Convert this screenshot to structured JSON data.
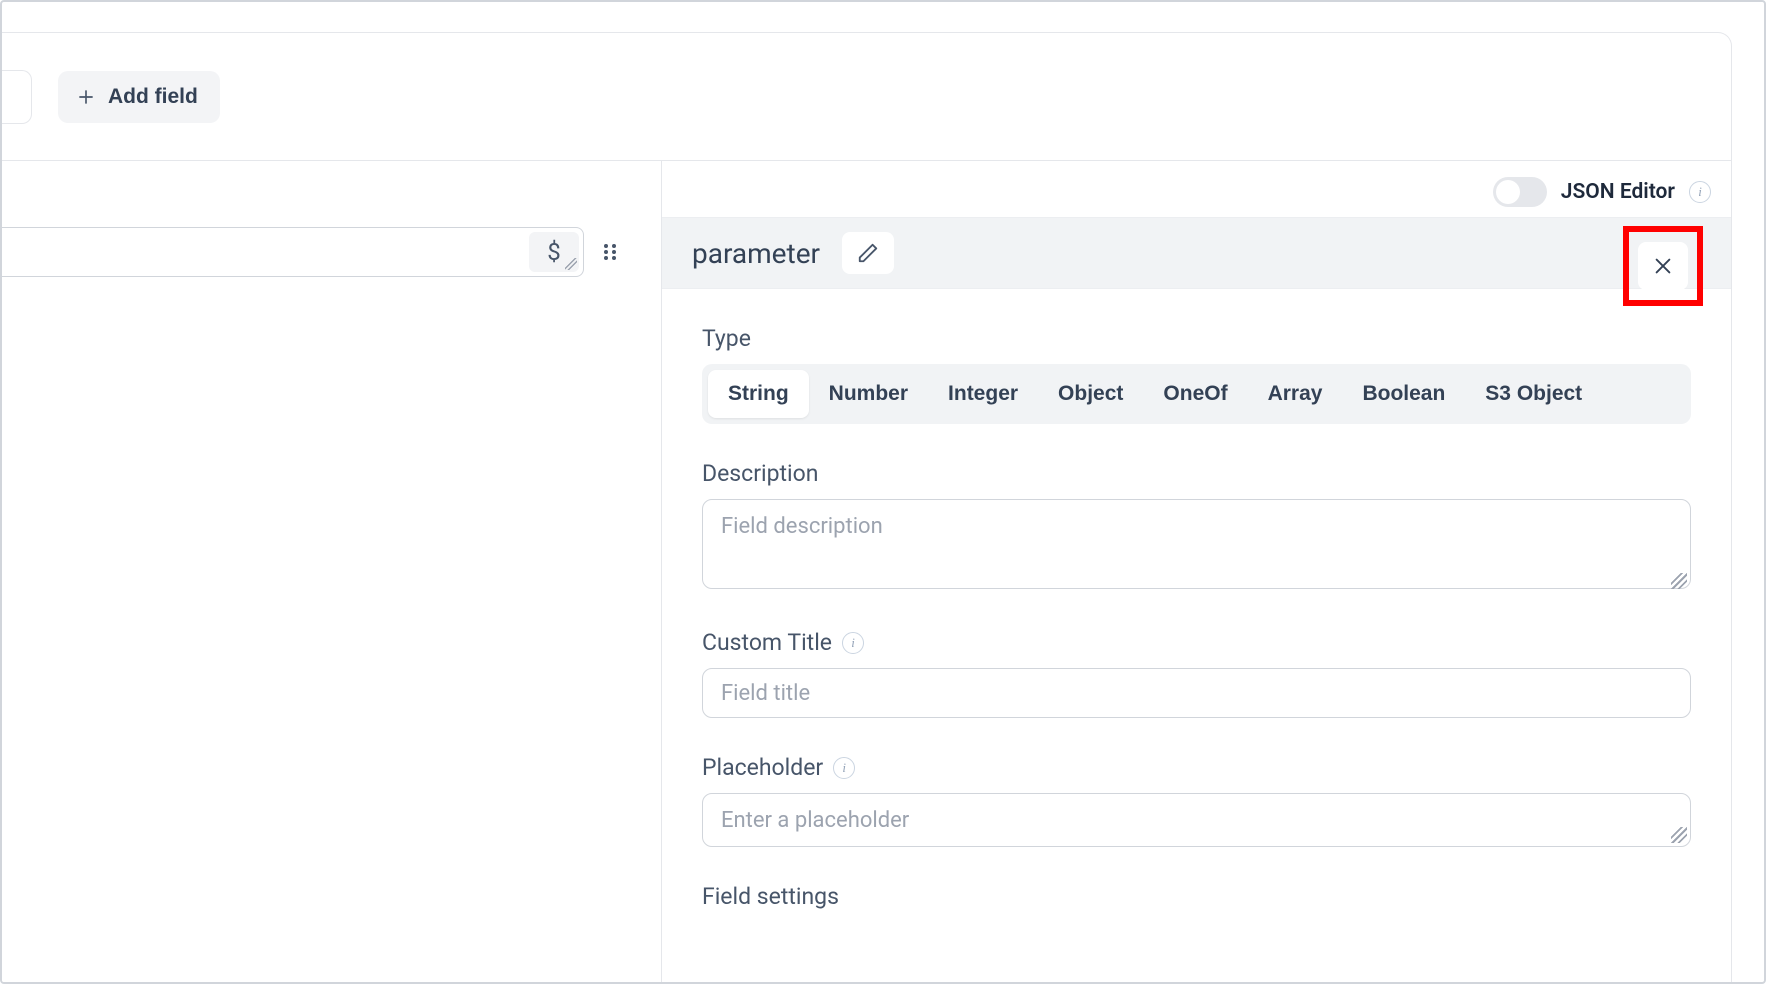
{
  "header": {
    "add_field_label": "Add field"
  },
  "left": {
    "dollar_badge": "$"
  },
  "right": {
    "json_editor_label": "JSON Editor",
    "param_name": "parameter",
    "type": {
      "label": "Type",
      "options": [
        "String",
        "Number",
        "Integer",
        "Object",
        "OneOf",
        "Array",
        "Boolean",
        "S3 Object"
      ],
      "selected": "String"
    },
    "description": {
      "label": "Description",
      "placeholder": "Field description",
      "value": ""
    },
    "custom_title": {
      "label": "Custom Title",
      "placeholder": "Field title",
      "value": ""
    },
    "placeholder": {
      "label": "Placeholder",
      "placeholder": "Enter a placeholder",
      "value": ""
    },
    "field_settings": {
      "label": "Field settings"
    }
  }
}
